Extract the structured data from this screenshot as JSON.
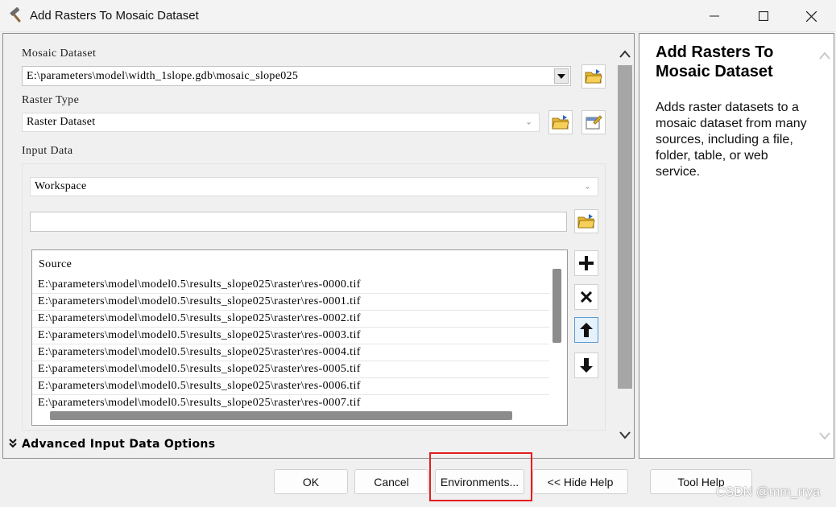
{
  "window": {
    "title": "Add Rasters To Mosaic Dataset"
  },
  "form": {
    "mosaic_dataset_label": "Mosaic Dataset",
    "mosaic_dataset_value": "E:\\parameters\\model\\width_1slope.gdb\\mosaic_slope025",
    "raster_type_label": "Raster Type",
    "raster_type_value": "Raster Dataset",
    "input_data_label": "Input Data",
    "input_data_mode": "Workspace",
    "input_path_value": "",
    "source_header": "Source",
    "source_items": [
      "E:\\parameters\\model\\model0.5\\results_slope025\\raster\\res-0000.tif",
      "E:\\parameters\\model\\model0.5\\results_slope025\\raster\\res-0001.tif",
      "E:\\parameters\\model\\model0.5\\results_slope025\\raster\\res-0002.tif",
      "E:\\parameters\\model\\model0.5\\results_slope025\\raster\\res-0003.tif",
      "E:\\parameters\\model\\model0.5\\results_slope025\\raster\\res-0004.tif",
      "E:\\parameters\\model\\model0.5\\results_slope025\\raster\\res-0005.tif",
      "E:\\parameters\\model\\model0.5\\results_slope025\\raster\\res-0006.tif",
      "E:\\parameters\\model\\model0.5\\results_slope025\\raster\\res-0007.tif"
    ],
    "advanced_section_label": "Advanced Input Data Options"
  },
  "help": {
    "title": "Add Rasters To Mosaic Dataset",
    "body": "Adds raster datasets to a mosaic dataset from many sources, including a file, folder, table, or web service."
  },
  "buttons": {
    "ok": "OK",
    "cancel": "Cancel",
    "environments": "Environments...",
    "hide_help": "<< Hide Help",
    "tool_help": "Tool Help"
  },
  "watermark": "CSDN @mm_rrya",
  "colors": {
    "highlight_box": "#e31e1e",
    "folder_icon": "#e8b730",
    "scrollbar_thumb": "#8c8c8c"
  }
}
